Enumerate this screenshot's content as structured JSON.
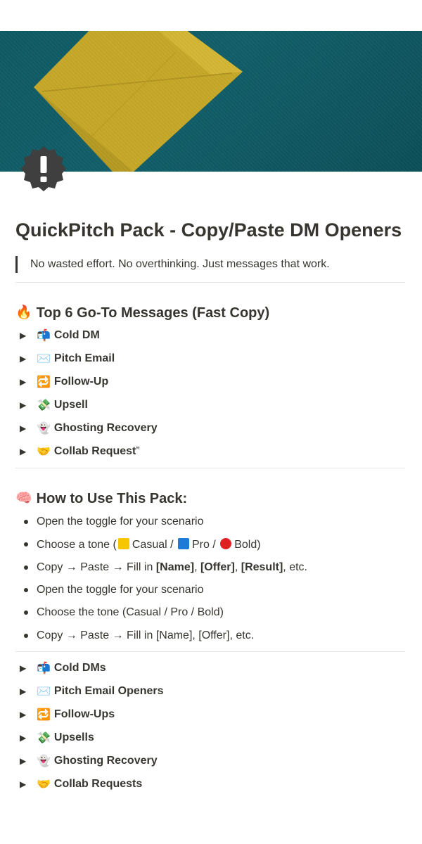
{
  "colors": {
    "cover": "#115e69",
    "envelope": "#c9ab2a",
    "text": "#37352f",
    "yellow": "#f6c600",
    "blue": "#1e7bd6",
    "red": "#e02020"
  },
  "page": {
    "title": "QuickPitch Pack - Copy/Paste DM Openers",
    "quote": "No wasted effort. No overthinking. Just messages that work.",
    "icon": "exclamation-badge-icon"
  },
  "top6": {
    "emoji": "🔥",
    "heading": "Top 6 Go-To Messages (Fast Copy)",
    "items": [
      {
        "emoji": "📬",
        "label": "Cold DM"
      },
      {
        "emoji": "✉️",
        "label": "Pitch Email"
      },
      {
        "emoji": "🔁",
        "label": "Follow-Up"
      },
      {
        "emoji": "💸",
        "label": "Upsell"
      },
      {
        "emoji": "👻",
        "label": "Ghosting Recovery"
      },
      {
        "emoji": "🤝",
        "label": "Collab Request",
        "suffix": "”"
      }
    ]
  },
  "howto": {
    "emoji": "🧠",
    "heading": "How to Use This Pack:",
    "b1": "Open the toggle for your scenario",
    "b2": {
      "pre": "Choose a tone (",
      "casual": "Casual / ",
      "pro": "Pro / ",
      "bold": "Bold)"
    },
    "b3": {
      "pre": "Copy → Paste → Fill in ",
      "name": "[Name]",
      "c1": ", ",
      "offer": "[Offer]",
      "c2": ", ",
      "result": "[Result]",
      "post": ", etc."
    },
    "b4": "Open the toggle for your scenario",
    "b5": "Choose the tone (Casual / Pro / Bold)",
    "b6": "Copy → Paste → Fill in [Name], [Offer], etc."
  },
  "sections": {
    "items": [
      {
        "emoji": "📬",
        "label": "Cold DMs"
      },
      {
        "emoji": "✉️",
        "label": "Pitch Email Openers"
      },
      {
        "emoji": "🔁",
        "label": "Follow-Ups"
      },
      {
        "emoji": "💸",
        "label": "Upsells"
      },
      {
        "emoji": "👻",
        "label": "Ghosting Recovery"
      },
      {
        "emoji": "🤝",
        "label": "Collab Requests"
      }
    ]
  }
}
